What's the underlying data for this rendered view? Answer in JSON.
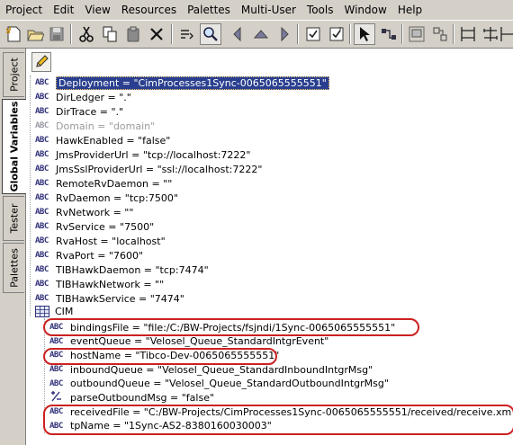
{
  "menu": [
    "Project",
    "Edit",
    "View",
    "Resources",
    "Palettes",
    "Multi-User",
    "Tools",
    "Window",
    "Help"
  ],
  "toolbar": {
    "icons": [
      "new-icon",
      "open-folder-icon",
      "save-icon",
      "cut-icon",
      "copy-icon",
      "paste-icon",
      "delete-icon",
      "find-icon",
      "search-zoom-icon",
      "back-icon",
      "up-icon",
      "forward-icon",
      "validate-icon",
      "checkin-icon",
      "select-pointer-icon",
      "connect-icon",
      "group-icon",
      "ungroup-icon",
      "align-left-icon",
      "align-center-icon",
      "align-right-icon"
    ]
  },
  "left_tabs": [
    "Project",
    "Global Variables",
    "Tester",
    "Palettes"
  ],
  "selected_tab": "Global Variables",
  "variables": [
    {
      "text": "Deployment = \"CimProcesses1Sync-0065065555551\"",
      "selected": true
    },
    {
      "text": "DirLedger = \".\""
    },
    {
      "text": "DirTrace = \".\""
    },
    {
      "text": "Domain = \"domain\"",
      "disabled": true
    },
    {
      "text": "HawkEnabled = \"false\""
    },
    {
      "text": "JmsProviderUrl = \"tcp://localhost:7222\""
    },
    {
      "text": "JmsSslProviderUrl = \"ssl://localhost:7222\""
    },
    {
      "text": "RemoteRvDaemon = \"\""
    },
    {
      "text": "RvDaemon = \"tcp:7500\""
    },
    {
      "text": "RvNetwork = \"\""
    },
    {
      "text": "RvService = \"7500\""
    },
    {
      "text": "RvaHost = \"localhost\""
    },
    {
      "text": "RvaPort = \"7600\""
    },
    {
      "text": "TIBHawkDaemon = \"tcp:7474\""
    },
    {
      "text": "TIBHawkNetwork = \"\""
    },
    {
      "text": "TIBHawkService = \"7474\""
    }
  ],
  "group": {
    "name": "CIM",
    "children": [
      {
        "text": "bindingsFile = \"file:/C:/BW-Projects/fsjndi/1Sync-0065065555551\"",
        "icon": "ABC"
      },
      {
        "text": "eventQueue = \"Velosel_Queue_StandardIntgrEvent\"",
        "icon": "ABC"
      },
      {
        "text": "hostName = \"Tibco-Dev-0065065555551\"",
        "icon": "ABC"
      },
      {
        "text": "inboundQueue = \"Velosel_Queue_StandardInboundIntgrMsg\"",
        "icon": "ABC"
      },
      {
        "text": "outboundQueue = \"Velosel_Queue_StandardOutboundIntgrMsg\"",
        "icon": "ABC"
      },
      {
        "text": "parseOutboundMsg = \"false\"",
        "icon": "bool"
      },
      {
        "text": "receivedFile = \"C:/BW-Projects/CimProcesses1Sync-0065065555551/received/receive.xm",
        "icon": "ABC"
      },
      {
        "text": "tpName = \"1Sync-AS2-8380160030003\"",
        "icon": "ABC"
      }
    ]
  },
  "abc_label": "ABC",
  "colors": {
    "chrome": "#d4d0c8",
    "selection": "#2a3f8f",
    "annotation": "#cc2020",
    "icon": "#30307a"
  }
}
